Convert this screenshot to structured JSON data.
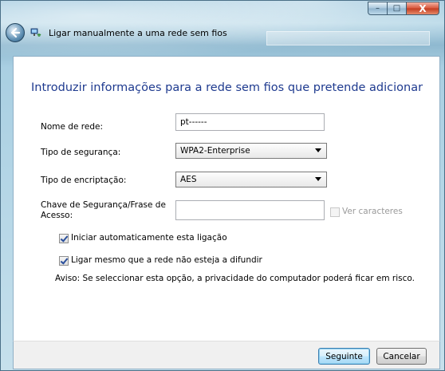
{
  "window": {
    "title": "Ligar manualmente a uma rede sem fios",
    "controls": {
      "minimize": "–",
      "maximize": "□",
      "close": "X"
    },
    "icons": {
      "back": "back-arrow-icon",
      "network": "network-icon"
    }
  },
  "heading": "Introduzir informações para a rede sem fios que pretende adicionar",
  "form": {
    "network_name": {
      "label": "Nome de rede:",
      "value": "pt------"
    },
    "security_type": {
      "label": "Tipo de segurança:",
      "value": "WPA2-Enterprise"
    },
    "encryption_type": {
      "label": "Tipo de encriptação:",
      "value": "AES"
    },
    "security_key": {
      "label_line1": "Chave de Segurança/Frase de",
      "label_line2": "Acesso:",
      "value": ""
    },
    "show_characters": {
      "label": "Ver caracteres",
      "checked": false,
      "enabled": false
    },
    "auto_start": {
      "label": "Iniciar automaticamente esta ligação",
      "checked": true
    },
    "connect_if_not_broadcasting": {
      "label": "Ligar mesmo que a rede não esteja a difundir",
      "checked": true
    },
    "warning": "Aviso: Se seleccionar esta opção, a privacidade do computador poderá ficar em risco."
  },
  "buttons": {
    "next": "Seguinte",
    "cancel": "Cancelar"
  },
  "colors": {
    "heading": "#1e3a8f",
    "frame": "#a9cfe2",
    "primary_button": "#bee6fd"
  }
}
